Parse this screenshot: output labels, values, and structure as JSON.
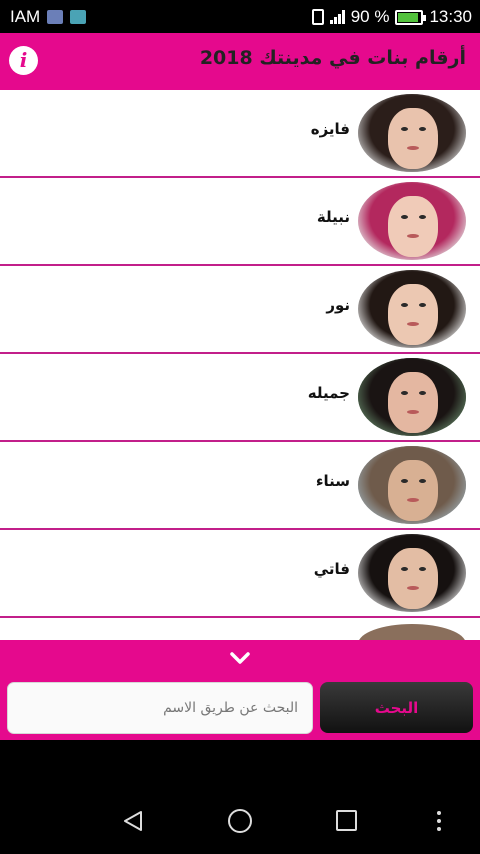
{
  "status_bar": {
    "carrier": "IAM",
    "battery_text": "90 %",
    "battery_level": 0.9,
    "time": "13:30",
    "icons": [
      "notification-icon",
      "image-icon",
      "vibrate-icon",
      "signal-icon",
      "battery-icon"
    ]
  },
  "app_bar": {
    "title": "أرقام بنات في مدينتك 2018",
    "info_label": "i",
    "accent_color": "#e5098d"
  },
  "list": {
    "items": [
      {
        "name": "فايزه",
        "hair": "#2b1e1a",
        "skin": "#e9c3ad",
        "bg": "#cfcfcf"
      },
      {
        "name": "نبيلة",
        "hair": "#b3285e",
        "skin": "#f0cbb8",
        "bg": "#e6e6e6"
      },
      {
        "name": "نور",
        "hair": "#221814",
        "skin": "#ecc8b2",
        "bg": "#e9e9e9"
      },
      {
        "name": "جميله",
        "hair": "#1a1413",
        "skin": "#e4b7a1",
        "bg": "#5f7d61"
      },
      {
        "name": "سناء",
        "hair": "#6f5b4b",
        "skin": "#d8b093",
        "bg": "#9aa7ad"
      },
      {
        "name": "فاتي",
        "hair": "#161110",
        "skin": "#e3bda4",
        "bg": "#dcdcdc"
      }
    ]
  },
  "search": {
    "placeholder": "البحث عن طريق الاسم",
    "value": "",
    "button_label": "البحث"
  },
  "nav": {
    "icons": [
      "back-icon",
      "home-icon",
      "recent-apps-icon",
      "overflow-menu-icon"
    ]
  }
}
